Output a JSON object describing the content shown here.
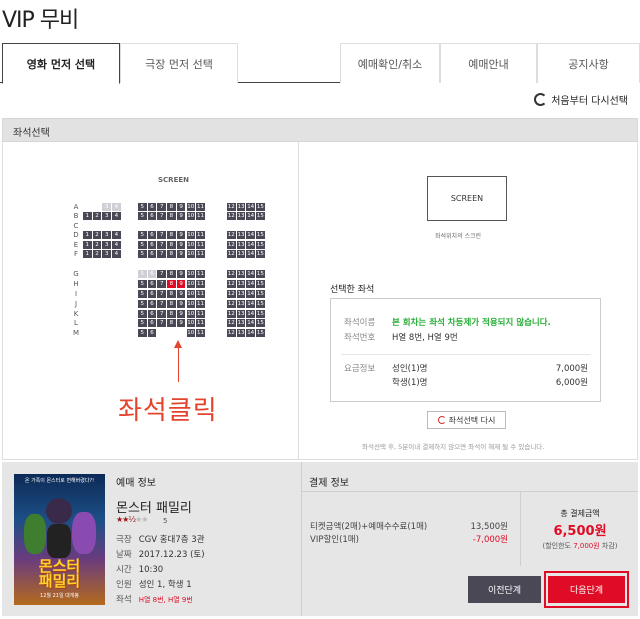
{
  "header": {
    "title": "VIP 무비"
  },
  "tabs": [
    {
      "label": "영화 먼저 선택",
      "active": true
    },
    {
      "label": "극장 먼저 선택",
      "active": false
    },
    {
      "label": "예매확인/취소",
      "active": false
    },
    {
      "label": "예매안내",
      "active": false
    },
    {
      "label": "공지사항",
      "active": false
    }
  ],
  "reset_label": "처음부터 다시선택",
  "section_title": "좌석선택",
  "seat_map": {
    "screen_label": "SCREEN",
    "rows": [
      "A",
      "B",
      "C",
      "D",
      "E",
      "F",
      "G",
      "H",
      "I",
      "J",
      "K",
      "L",
      "M"
    ],
    "selected": [
      "H8",
      "H9"
    ],
    "annotation": "좌석클릭"
  },
  "screen_preview": {
    "label": "SCREEN",
    "caption": "좌석위치의 스크린"
  },
  "selected_seats": {
    "heading": "선택한 좌석",
    "name_label": "좌석이름",
    "name_value": "본 회차는 좌석 차등제가 적용되지 않습니다.",
    "number_label": "좌석번호",
    "number_value": "H열 8번, H열 9번",
    "fare_label": "요금정보",
    "fares": [
      {
        "type": "성인(1)명",
        "price": "7,000원"
      },
      {
        "type": "학생(1)명",
        "price": "6,000원"
      }
    ],
    "reselect_label": "좌석선택 다시",
    "notice": "좌석선택 후, 5분이내 결제하지 않으면 좌석이 해제 될 수 있습니다."
  },
  "booking_info": {
    "heading": "예매 정보",
    "poster_top": "온 가족이 몬스터로 변해버렸다?!",
    "poster_title": "몬스터\n패밀리",
    "poster_date": "12월 21일 대개봉",
    "movie_title": "몬스터 패밀리",
    "rating_value": 2.5,
    "rating": "5",
    "theater_label": "극장",
    "theater": "CGV 홍대7층 3관",
    "date_label": "날짜",
    "date": "2017.12.23 (토)",
    "time_label": "시간",
    "time": "10:30",
    "people_label": "인원",
    "people": "성인 1, 학생 1",
    "seat_label": "좌석",
    "seats": "H열 8번, H열 9번"
  },
  "payment": {
    "heading": "결제 정보",
    "ticket_label": "티켓금액(2매)+예매수수료(1매)",
    "ticket_value": "13,500원",
    "vip_label": "VIP할인(1매)",
    "vip_value": "-7,000원",
    "total_label": "총 결제금액",
    "total_value": "6,500원",
    "limit_prefix": "(할인한도 ",
    "limit_value": "7,000원",
    "limit_suffix": " 차감)"
  },
  "buttons": {
    "prev": "이전단계",
    "next": "다음단계"
  },
  "colors": {
    "seat": "#4b4856",
    "selected_seat": "#e00b25",
    "annotation": "#e4442d",
    "accent": "#e00b25"
  }
}
